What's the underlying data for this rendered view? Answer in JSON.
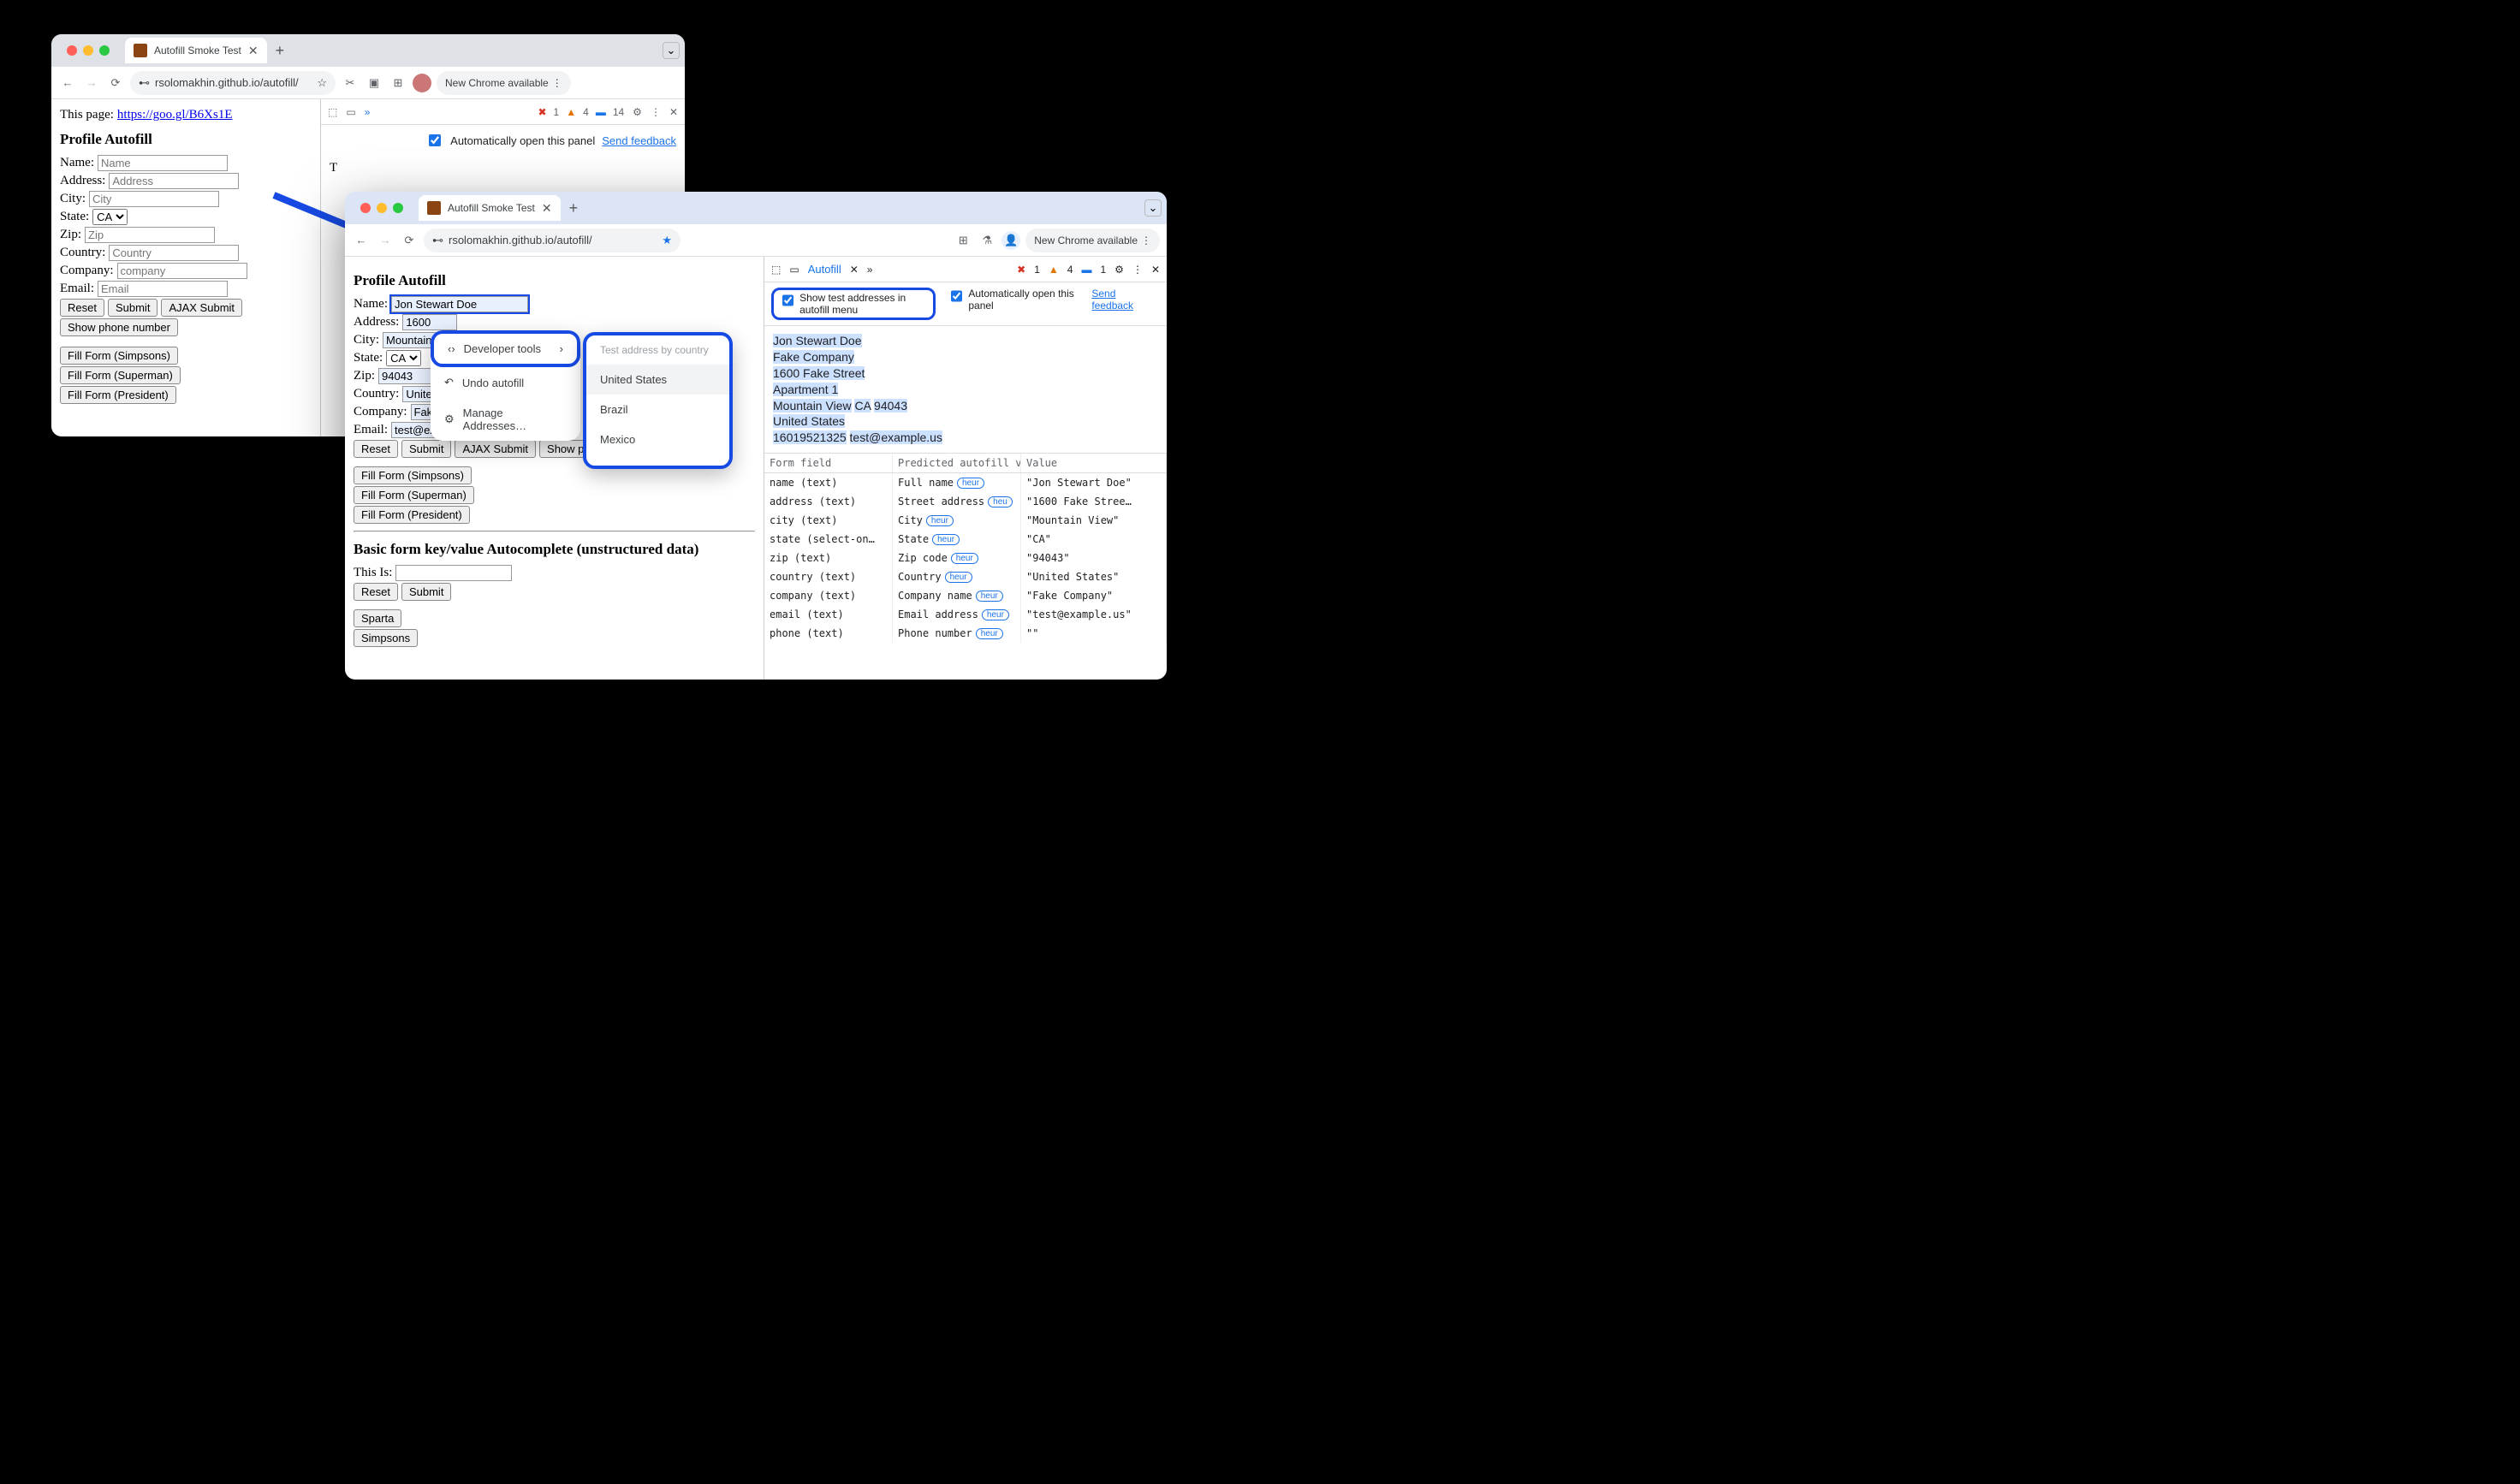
{
  "win1": {
    "tab_title": "Autofill Smoke Test",
    "url": "rsolomakhin.github.io/autofill/",
    "new_chrome": "New Chrome available",
    "page": {
      "this_page": "This page: ",
      "link": "https://goo.gl/B6Xs1E",
      "h2": "Profile Autofill",
      "labels": {
        "name": "Name:",
        "address": "Address:",
        "city": "City:",
        "state": "State:",
        "zip": "Zip:",
        "country": "Country:",
        "company": "Company:",
        "email": "Email:"
      },
      "placeholders": {
        "name": "Name",
        "address": "Address",
        "city": "City",
        "zip": "Zip",
        "country": "Country",
        "company": "company",
        "email": "Email"
      },
      "state_value": "CA",
      "buttons": {
        "reset": "Reset",
        "submit": "Submit",
        "ajax": "AJAX Submit",
        "showphone": "Show phone number",
        "simpsons": "Fill Form (Simpsons)",
        "superman": "Fill Form (Superman)",
        "president": "Fill Form (President)"
      },
      "side_text": "T"
    },
    "dt": {
      "err": "1",
      "warn": "4",
      "info": "14",
      "auto_open": "Automatically open this panel",
      "feedback": "Send feedback"
    }
  },
  "win2": {
    "tab_title": "Autofill Smoke Test",
    "url": "rsolomakhin.github.io/autofill/",
    "new_chrome": "New Chrome available",
    "page": {
      "h2": "Profile Autofill",
      "labels": {
        "name": "Name:",
        "address": "Address:",
        "city": "City:",
        "state": "State:",
        "zip": "Zip:",
        "country": "Country:",
        "company": "Company:",
        "email": "Email:"
      },
      "values": {
        "name": "Jon Stewart Doe",
        "address": "1600",
        "city": "Mountain",
        "state": "CA",
        "zip": "94043",
        "country": "United",
        "company": "Fake",
        "email": "test@example.us"
      },
      "buttons": {
        "reset": "Reset",
        "submit": "Submit",
        "ajax": "AJAX Submit",
        "showphone": "Show ph",
        "simpsons": "Fill Form (Simpsons)",
        "superman": "Fill Form (Superman)",
        "president": "Fill Form (President)"
      },
      "h2b": "Basic form key/value Autocomplete (unstructured data)",
      "thisis": "This Is:",
      "b_reset": "Reset",
      "b_submit": "Submit",
      "sparta": "Sparta",
      "simpsons2": "Simpsons"
    },
    "dt": {
      "tab": "Autofill",
      "err": "1",
      "warn": "4",
      "info": "1",
      "opt1": "Show test addresses in autofill menu",
      "opt2": "Automatically open this panel",
      "feedback": "Send feedback",
      "address": {
        "l1": "Jon Stewart Doe",
        "l2": "Fake Company",
        "l3": "1600 Fake Street",
        "l4": "Apartment 1",
        "l5a": "Mountain View",
        "l5b": "CA",
        "l5c": "94043",
        "l6": "United States",
        "l7a": "16019521325",
        "l7b": "test@example.us"
      },
      "cols": {
        "c1": "Form field",
        "c2": "Predicted autofill v…",
        "c3": "Value"
      },
      "rows": [
        {
          "f": "name (text)",
          "p": "Full name",
          "h": "heur",
          "v": "\"Jon Stewart Doe\""
        },
        {
          "f": "address (text)",
          "p": "Street address",
          "h": "heu",
          "v": "\"1600 Fake Stree…"
        },
        {
          "f": "city (text)",
          "p": "City",
          "h": "heur",
          "v": "\"Mountain View\""
        },
        {
          "f": "state (select-on…",
          "p": "State",
          "h": "heur",
          "v": "\"CA\""
        },
        {
          "f": "zip (text)",
          "p": "Zip code",
          "h": "heur",
          "v": "\"94043\""
        },
        {
          "f": "country (text)",
          "p": "Country",
          "h": "heur",
          "v": "\"United States\""
        },
        {
          "f": "company (text)",
          "p": "Company name",
          "h": "heur",
          "v": "\"Fake Company\""
        },
        {
          "f": "email (text)",
          "p": "Email address",
          "h": "heur",
          "v": "\"test@example.us\""
        },
        {
          "f": "phone (text)",
          "p": "Phone number",
          "h": "heur",
          "v": "\"\""
        }
      ]
    }
  },
  "ctx1": {
    "dev": "Developer tools",
    "undo": "Undo autofill",
    "manage": "Manage Addresses…"
  },
  "ctx2": {
    "head": "Test address by country",
    "us": "United States",
    "br": "Brazil",
    "mx": "Mexico"
  }
}
